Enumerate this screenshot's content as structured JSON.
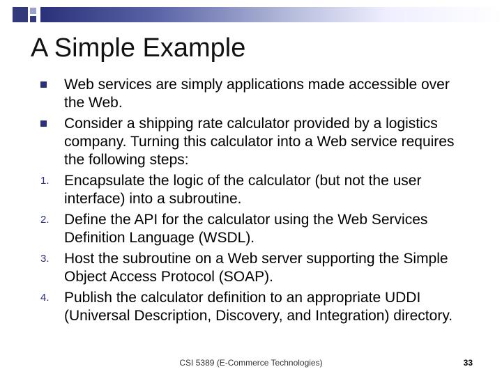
{
  "title": "A Simple Example",
  "bullets": [
    {
      "marker_type": "square",
      "marker": "",
      "text": "Web services are simply applications made accessible over the Web."
    },
    {
      "marker_type": "square",
      "marker": "",
      "text": "Consider a shipping rate calculator provided by a logistics company. Turning this calculator into a Web service requires the following steps:"
    },
    {
      "marker_type": "number",
      "marker": "1.",
      "text": "Encapsulate the logic of the calculator (but not the user interface) into a subroutine."
    },
    {
      "marker_type": "number",
      "marker": "2.",
      "text": "Define the API for the calculator using the Web Services Definition Language (WSDL)."
    },
    {
      "marker_type": "number",
      "marker": "3.",
      "text": "Host the subroutine on a Web server supporting the Simple Object Access Protocol (SOAP)."
    },
    {
      "marker_type": "number",
      "marker": "4.",
      "text": "Publish the calculator definition to an appropriate UDDI (Universal Description, Discovery, and Integration) directory."
    }
  ],
  "footer": "CSI 5389 (E-Commerce Technologies)",
  "page_number": "33"
}
